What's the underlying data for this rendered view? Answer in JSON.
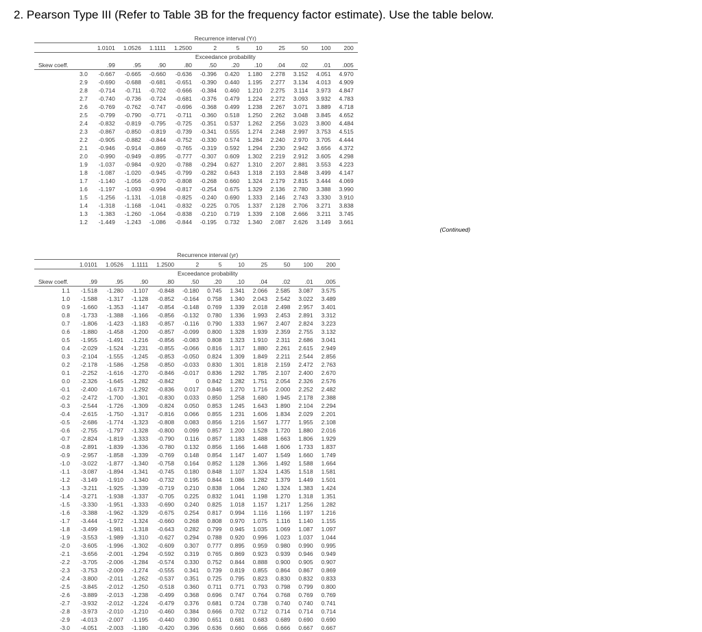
{
  "question": "2. Pearson Type III (Refer to Table 3B for the frequency factor estimate). Use the table below.",
  "header": {
    "recurrence": "Recurrence interval (Yr)",
    "recurrence2": "Recurrence interval (yr)",
    "exceedance": "Exceedance probability",
    "return_periods": [
      "1.0101",
      "1.0526",
      "1.1111",
      "1.2500",
      "2",
      "5",
      "10",
      "25",
      "50",
      "100",
      "200"
    ],
    "probs": [
      ".99",
      ".95",
      ".90",
      ".80",
      ".50",
      ".20",
      ".10",
      ".04",
      ".02",
      ".01",
      ".005"
    ],
    "skew_label": "Skew coeff.",
    "continued": "(Continued)"
  },
  "table1": [
    {
      "s": "3.0",
      "v": [
        "-0.667",
        "-0.665",
        "-0.660",
        "-0.636",
        "-0.396",
        "0.420",
        "1.180",
        "2.278",
        "3.152",
        "4.051",
        "4.970"
      ]
    },
    {
      "s": "2.9",
      "v": [
        "-0.690",
        "-0.688",
        "-0.681",
        "-0.651",
        "-0.390",
        "0.440",
        "1.195",
        "2.277",
        "3.134",
        "4.013",
        "4.909"
      ]
    },
    {
      "s": "2.8",
      "v": [
        "-0.714",
        "-0.711",
        "-0.702",
        "-0.666",
        "-0.384",
        "0.460",
        "1.210",
        "2.275",
        "3.114",
        "3.973",
        "4.847"
      ]
    },
    {
      "s": "2.7",
      "v": [
        "-0.740",
        "-0.736",
        "-0.724",
        "-0.681",
        "-0.376",
        "0.479",
        "1.224",
        "2.272",
        "3.093",
        "3.932",
        "4.783"
      ]
    },
    {
      "s": "2.6",
      "v": [
        "-0.769",
        "-0.762",
        "-0.747",
        "-0.696",
        "-0.368",
        "0.499",
        "1.238",
        "2.267",
        "3.071",
        "3.889",
        "4.718"
      ]
    },
    {
      "s": "2.5",
      "v": [
        "-0.799",
        "-0.790",
        "-0.771",
        "-0.711",
        "-0.360",
        "0.518",
        "1.250",
        "2.262",
        "3.048",
        "3.845",
        "4.652"
      ]
    },
    {
      "s": "2.4",
      "v": [
        "-0.832",
        "-0.819",
        "-0.795",
        "-0.725",
        "-0.351",
        "0.537",
        "1.262",
        "2.256",
        "3.023",
        "3.800",
        "4.484"
      ]
    },
    {
      "s": "2.3",
      "v": [
        "-0.867",
        "-0.850",
        "-0.819",
        "-0.739",
        "-0.341",
        "0.555",
        "1.274",
        "2.248",
        "2.997",
        "3.753",
        "4.515"
      ]
    },
    {
      "s": "2.2",
      "v": [
        "-0.905",
        "-0.882",
        "-0.844",
        "-0.752",
        "-0.330",
        "0.574",
        "1.284",
        "2.240",
        "2.970",
        "3.705",
        "4.444"
      ]
    },
    {
      "s": "2.1",
      "v": [
        "-0.946",
        "-0.914",
        "-0.869",
        "-0.765",
        "-0.319",
        "0.592",
        "1.294",
        "2.230",
        "2.942",
        "3.656",
        "4.372"
      ]
    },
    {
      "s": "2.0",
      "v": [
        "-0.990",
        "-0.949",
        "-0.895",
        "-0.777",
        "-0.307",
        "0.609",
        "1.302",
        "2.219",
        "2.912",
        "3.605",
        "4.298"
      ]
    },
    {
      "s": "1.9",
      "v": [
        "-1.037",
        "-0.984",
        "-0.920",
        "-0.788",
        "-0.294",
        "0.627",
        "1.310",
        "2.207",
        "2.881",
        "3.553",
        "4.223"
      ]
    },
    {
      "s": "1.8",
      "v": [
        "-1.087",
        "-1.020",
        "-0.945",
        "-0.799",
        "-0.282",
        "0.643",
        "1.318",
        "2.193",
        "2.848",
        "3.499",
        "4.147"
      ]
    },
    {
      "s": "1.7",
      "v": [
        "-1.140",
        "-1.056",
        "-0.970",
        "-0.808",
        "-0.268",
        "0.660",
        "1.324",
        "2.179",
        "2.815",
        "3.444",
        "4.069"
      ]
    },
    {
      "s": "1.6",
      "v": [
        "-1.197",
        "-1.093",
        "-0.994",
        "-0.817",
        "-0.254",
        "0.675",
        "1.329",
        "2.136",
        "2.780",
        "3.388",
        "3.990"
      ]
    },
    {
      "s": "1.5",
      "v": [
        "-1.256",
        "-1.131",
        "-1.018",
        "-0.825",
        "-0.240",
        "0.690",
        "1.333",
        "2.146",
        "2.743",
        "3.330",
        "3.910"
      ]
    },
    {
      "s": "1.4",
      "v": [
        "-1.318",
        "-1.168",
        "-1.041",
        "-0.832",
        "-0.225",
        "0.705",
        "1.337",
        "2.128",
        "2.706",
        "3.271",
        "3.838"
      ]
    },
    {
      "s": "1.3",
      "v": [
        "-1.383",
        "-1.260",
        "-1.064",
        "-0.838",
        "-0.210",
        "0.719",
        "1.339",
        "2.108",
        "2.666",
        "3.211",
        "3.745"
      ]
    },
    {
      "s": "1.2",
      "v": [
        "-1.449",
        "-1.243",
        "-1.086",
        "-0.844",
        "-0.195",
        "0.732",
        "1.340",
        "2.087",
        "2.626",
        "3.149",
        "3.661"
      ]
    }
  ],
  "table2": [
    {
      "s": "1.1",
      "v": [
        "-1.518",
        "-1.280",
        "-1.107",
        "-0.848",
        "-0.180",
        "0.745",
        "1.341",
        "2.066",
        "2.585",
        "3.087",
        "3.575"
      ]
    },
    {
      "s": "1.0",
      "v": [
        "-1.588",
        "-1.317",
        "-1.128",
        "-0.852",
        "-0.164",
        "0.758",
        "1.340",
        "2.043",
        "2.542",
        "3.022",
        "3.489"
      ]
    },
    {
      "s": "0.9",
      "v": [
        "-1.660",
        "-1.353",
        "-1.147",
        "-0.854",
        "-0.148",
        "0.769",
        "1.339",
        "2.018",
        "2.498",
        "2.957",
        "3.401"
      ]
    },
    {
      "s": "0.8",
      "v": [
        "-1.733",
        "-1.388",
        "-1.166",
        "-0.856",
        "-0.132",
        "0.780",
        "1.336",
        "1.993",
        "2.453",
        "2.891",
        "3.312"
      ]
    },
    {
      "s": "0.7",
      "v": [
        "-1.806",
        "-1.423",
        "-1.183",
        "-0.857",
        "-0.116",
        "0.790",
        "1.333",
        "1.967",
        "2.407",
        "2.824",
        "3.223"
      ]
    },
    {
      "s": "0.6",
      "v": [
        "-1.880",
        "-1.458",
        "-1.200",
        "-0.857",
        "-0.099",
        "0.800",
        "1.328",
        "1.939",
        "2.359",
        "2.755",
        "3.132"
      ]
    },
    {
      "s": "0.5",
      "v": [
        "-1.955",
        "-1.491",
        "-1.216",
        "-0.856",
        "-0.083",
        "0.808",
        "1.323",
        "1.910",
        "2.311",
        "2.686",
        "3.041"
      ]
    },
    {
      "s": "0.4",
      "v": [
        "-2.029",
        "-1.524",
        "-1.231",
        "-0.855",
        "-0.066",
        "0.816",
        "1.317",
        "1.880",
        "2.261",
        "2.615",
        "2.949"
      ]
    },
    {
      "s": "0.3",
      "v": [
        "-2.104",
        "-1.555",
        "-1.245",
        "-0.853",
        "-0.050",
        "0.824",
        "1.309",
        "1.849",
        "2.211",
        "2.544",
        "2.856"
      ]
    },
    {
      "s": "0.2",
      "v": [
        "-2.178",
        "-1.586",
        "-1.258",
        "-0.850",
        "-0.033",
        "0.830",
        "1.301",
        "1.818",
        "2.159",
        "2.472",
        "2.763"
      ]
    },
    {
      "s": "0.1",
      "v": [
        "-2.252",
        "-1.616",
        "-1.270",
        "-0.846",
        "-0.017",
        "0.836",
        "1.292",
        "1.785",
        "2.107",
        "2.400",
        "2.670"
      ]
    },
    {
      "s": "0.0",
      "v": [
        "-2.326",
        "-1.645",
        "-1.282",
        "-0.842",
        "0",
        "0.842",
        "1.282",
        "1.751",
        "2.054",
        "2.326",
        "2.576"
      ]
    },
    {
      "s": "-0.1",
      "v": [
        "-2.400",
        "-1.673",
        "-1.292",
        "-0.836",
        "0.017",
        "0.846",
        "1.270",
        "1.716",
        "2.000",
        "2.252",
        "2.482"
      ]
    },
    {
      "s": "-0.2",
      "v": [
        "-2.472",
        "-1.700",
        "-1.301",
        "-0.830",
        "0.033",
        "0.850",
        "1.258",
        "1.680",
        "1.945",
        "2.178",
        "2.388"
      ]
    },
    {
      "s": "-0.3",
      "v": [
        "-2.544",
        "-1.726",
        "-1.309",
        "-0.824",
        "0.050",
        "0.853",
        "1.245",
        "1.643",
        "1.890",
        "2.104",
        "2.294"
      ]
    },
    {
      "s": "-0.4",
      "v": [
        "-2.615",
        "-1.750",
        "-1.317",
        "-0.816",
        "0.066",
        "0.855",
        "1.231",
        "1.606",
        "1.834",
        "2.029",
        "2.201"
      ]
    },
    {
      "s": "-0.5",
      "v": [
        "-2.686",
        "-1.774",
        "-1.323",
        "-0.808",
        "0.083",
        "0.856",
        "1.216",
        "1.567",
        "1.777",
        "1.955",
        "2.108"
      ]
    },
    {
      "s": "-0.6",
      "v": [
        "-2.755",
        "-1.797",
        "-1.328",
        "-0.800",
        "0.099",
        "0.857",
        "1.200",
        "1.528",
        "1.720",
        "1.880",
        "2.016"
      ]
    },
    {
      "s": "-0.7",
      "v": [
        "-2.824",
        "-1.819",
        "-1.333",
        "-0.790",
        "0.116",
        "0.857",
        "1.183",
        "1.488",
        "1.663",
        "1.806",
        "1.929"
      ]
    },
    {
      "s": "-0.8",
      "v": [
        "-2.891",
        "-1.839",
        "-1.336",
        "-0.780",
        "0.132",
        "0.856",
        "1.166",
        "1.448",
        "1.606",
        "1.733",
        "1.837"
      ]
    },
    {
      "s": "-0.9",
      "v": [
        "-2.957",
        "-1.858",
        "-1.339",
        "-0.769",
        "0.148",
        "0.854",
        "1.147",
        "1.407",
        "1.549",
        "1.660",
        "1.749"
      ]
    },
    {
      "s": "-1.0",
      "v": [
        "-3.022",
        "-1.877",
        "-1.340",
        "-0.758",
        "0.164",
        "0.852",
        "1.128",
        "1.366",
        "1.492",
        "1.588",
        "1.664"
      ]
    },
    {
      "s": "-1.1",
      "v": [
        "-3.087",
        "-1.894",
        "-1.341",
        "-0.745",
        "0.180",
        "0.848",
        "1.107",
        "1.324",
        "1.435",
        "1.518",
        "1.581"
      ]
    },
    {
      "s": "-1.2",
      "v": [
        "-3.149",
        "-1.910",
        "-1.340",
        "-0.732",
        "0.195",
        "0.844",
        "1.086",
        "1.282",
        "1.379",
        "1.449",
        "1.501"
      ]
    },
    {
      "s": "-1.3",
      "v": [
        "-3.211",
        "-1.925",
        "-1.339",
        "-0.719",
        "0.210",
        "0.838",
        "1.064",
        "1.240",
        "1.324",
        "1.383",
        "1.424"
      ]
    },
    {
      "s": "-1.4",
      "v": [
        "-3.271",
        "-1.938",
        "-1.337",
        "-0.705",
        "0.225",
        "0.832",
        "1.041",
        "1.198",
        "1.270",
        "1.318",
        "1.351"
      ]
    },
    {
      "s": "-1.5",
      "v": [
        "-3.330",
        "-1.951",
        "-1.333",
        "-0.690",
        "0.240",
        "0.825",
        "1.018",
        "1.157",
        "1.217",
        "1.256",
        "1.282"
      ]
    },
    {
      "s": "-1.6",
      "v": [
        "-3.388",
        "-1.962",
        "-1.329",
        "-0.675",
        "0.254",
        "0.817",
        "0.994",
        "1.116",
        "1.166",
        "1.197",
        "1.216"
      ]
    },
    {
      "s": "-1.7",
      "v": [
        "-3.444",
        "-1.972",
        "-1.324",
        "-0.660",
        "0.268",
        "0.808",
        "0.970",
        "1.075",
        "1.116",
        "1.140",
        "1.155"
      ]
    },
    {
      "s": "-1.8",
      "v": [
        "-3.499",
        "-1.981",
        "-1.318",
        "-0.643",
        "0.282",
        "0.799",
        "0.945",
        "1.035",
        "1.069",
        "1.087",
        "1.097"
      ]
    },
    {
      "s": "-1.9",
      "v": [
        "-3.553",
        "-1.989",
        "-1.310",
        "-0.627",
        "0.294",
        "0.788",
        "0.920",
        "0.996",
        "1.023",
        "1.037",
        "1.044"
      ]
    },
    {
      "s": "-2.0",
      "v": [
        "-3.605",
        "-1.996",
        "-1.302",
        "-0.609",
        "0.307",
        "0.777",
        "0.895",
        "0.959",
        "0.980",
        "0.990",
        "0.995"
      ]
    },
    {
      "s": "-2.1",
      "v": [
        "-3.656",
        "-2.001",
        "-1.294",
        "-0.592",
        "0.319",
        "0.765",
        "0.869",
        "0.923",
        "0.939",
        "0.946",
        "0.949"
      ]
    },
    {
      "s": "-2.2",
      "v": [
        "-3.705",
        "-2.006",
        "-1.284",
        "-0.574",
        "0.330",
        "0.752",
        "0.844",
        "0.888",
        "0.900",
        "0.905",
        "0.907"
      ]
    },
    {
      "s": "-2.3",
      "v": [
        "-3.753",
        "-2.009",
        "-1.274",
        "-0.555",
        "0.341",
        "0.739",
        "0.819",
        "0.855",
        "0.864",
        "0.867",
        "0.869"
      ]
    },
    {
      "s": "-2.4",
      "v": [
        "-3.800",
        "-2.011",
        "-1.262",
        "-0.537",
        "0.351",
        "0.725",
        "0.795",
        "0.823",
        "0.830",
        "0.832",
        "0.833"
      ]
    },
    {
      "s": "-2.5",
      "v": [
        "-3.845",
        "-2.012",
        "-1.250",
        "-0.518",
        "0.360",
        "0.711",
        "0.771",
        "0.793",
        "0.798",
        "0.799",
        "0.800"
      ]
    },
    {
      "s": "-2.6",
      "v": [
        "-3.889",
        "-2.013",
        "-1.238",
        "-0.499",
        "0.368",
        "0.696",
        "0.747",
        "0.764",
        "0.768",
        "0.769",
        "0.769"
      ]
    },
    {
      "s": "-2.7",
      "v": [
        "-3.932",
        "-2.012",
        "-1.224",
        "-0.479",
        "0.376",
        "0.681",
        "0.724",
        "0.738",
        "0.740",
        "0.740",
        "0.741"
      ]
    },
    {
      "s": "-2.8",
      "v": [
        "-3.973",
        "-2.010",
        "-1.210",
        "-0.460",
        "0.384",
        "0.666",
        "0.702",
        "0.712",
        "0.714",
        "0.714",
        "0.714"
      ]
    },
    {
      "s": "-2.9",
      "v": [
        "-4.013",
        "-2.007",
        "-1.195",
        "-0.440",
        "0.390",
        "0.651",
        "0.681",
        "0.683",
        "0.689",
        "0.690",
        "0.690"
      ]
    },
    {
      "s": "-3.0",
      "v": [
        "-4.051",
        "-2.003",
        "-1.180",
        "-0.420",
        "0.396",
        "0.636",
        "0.660",
        "0.666",
        "0.666",
        "0.667",
        "0.667"
      ]
    }
  ]
}
